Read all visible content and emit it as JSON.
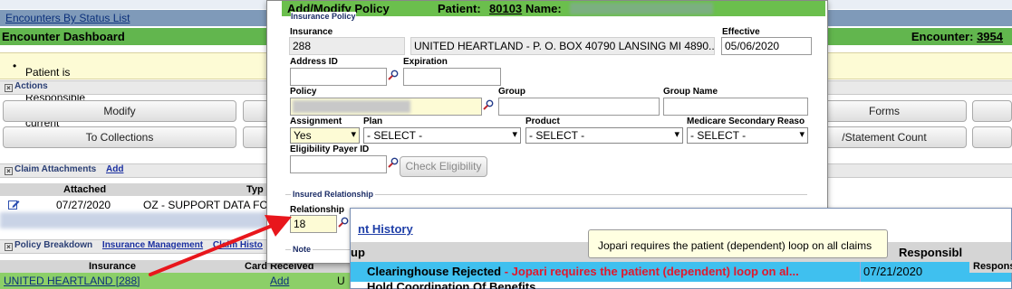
{
  "page": {
    "nav_link": "Encounters By Status List",
    "dashboard_title": "Encounter Dashboard",
    "encounter_label": "Encounter:",
    "encounter_number": "3954",
    "notice_text": "Patient is NOT Responsible on the current Profile",
    "actions_label": "Actions",
    "buttons": {
      "modify": "Modify",
      "to_collections": "To Collections",
      "forms": "Forms",
      "statement_count": "/Statement Count"
    },
    "attachments": {
      "label": "Claim Attachments",
      "add_link": "Add",
      "col_attached": "Attached",
      "col_type": "Typ",
      "row_date": "07/27/2020",
      "row_type": "OZ - SUPPORT DATA FO"
    },
    "policy_breakdown": {
      "label": "Policy Breakdown",
      "insurance_mgmt_link": "Insurance Management",
      "claim_history_link": "Claim Histo",
      "col_insurance": "Insurance",
      "col_card_received": "Card Received",
      "row_insurance": "UNITED HEARTLAND [288]",
      "row_card": "Add",
      "row_extra": "U"
    }
  },
  "modal": {
    "title": "Add/Modify Policy",
    "patient_label": "Patient:",
    "patient_id": "80103",
    "name_label": "Name:",
    "fieldset_policy": "Insurance Policy",
    "insurance_label": "Insurance",
    "insurance_code": "288",
    "insurance_name": "UNITED HEARTLAND - P. O. BOX 40790 LANSING MI 4890...",
    "effective_label": "Effective",
    "effective_value": "05/06/2020",
    "address_id_label": "Address ID",
    "expiration_label": "Expiration",
    "policy_label": "Policy",
    "group_label": "Group",
    "group_name_label": "Group Name",
    "assignment_label": "Assignment",
    "assignment_value": "Yes",
    "plan_label": "Plan",
    "plan_value": "- SELECT -",
    "product_label": "Product",
    "product_value": "- SELECT -",
    "medicare_label": "Medicare Secondary Reaso",
    "medicare_value": "- SELECT -",
    "eligibility_payer_label": "Eligibility Payer ID",
    "check_eligibility": "Check Eligibility",
    "fieldset_insured": "Insured Relationship",
    "relationship_label": "Relationship",
    "relationship_value": "18",
    "note_label": "Note"
  },
  "history": {
    "link": "nt History",
    "col_fragment": "up",
    "col_responsible_1": "Responsibl",
    "col_responsible_2": "Respons",
    "row1_status": "Clearinghouse Rejected",
    "row1_detail": " - Jopari requires the patient (dependent) loop on al...",
    "row1_date": "07/21/2020",
    "row2_status": "Hold Coordination Of Benefits"
  },
  "tooltip": "Jopari requires the patient (dependent) loop on all claims",
  "colors": {
    "accent_green": "#62b64e",
    "header_blue": "#7f9ab9",
    "highlight_blue": "#3fc0ef",
    "error_red": "#e0182d",
    "arrow_red": "#e8161c"
  }
}
